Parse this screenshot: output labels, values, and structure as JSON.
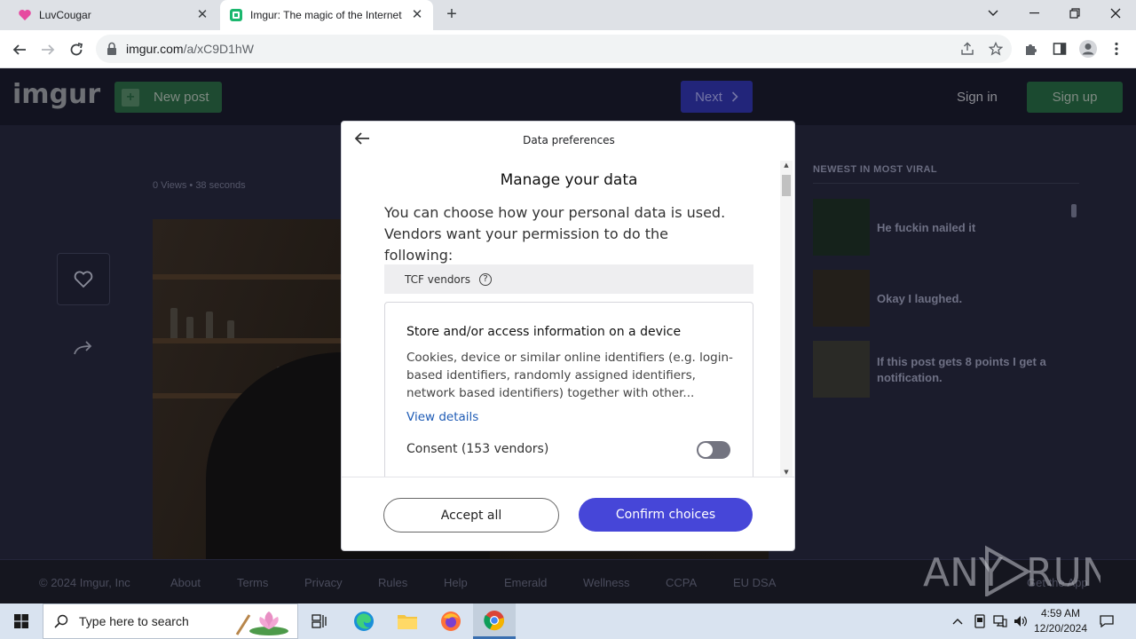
{
  "browser": {
    "tabs": [
      {
        "title": "LuvCougar",
        "favicon": "heart-favicon"
      },
      {
        "title": "Imgur: The magic of the Internet",
        "favicon": "imgur-favicon",
        "active": true
      }
    ],
    "url_host": "imgur.com",
    "url_path": "/a/xC9D1hW"
  },
  "imgur": {
    "logo": "imgur",
    "new_post": "New post",
    "next": "Next",
    "sign_in": "Sign in",
    "sign_up": "Sign up",
    "views": "0 Views",
    "age": "38 seconds",
    "sidebar_title": "NEWEST IN MOST VIRAL",
    "viral": [
      {
        "title": "He fuckin nailed it"
      },
      {
        "title": "Okay I laughed."
      },
      {
        "title": "If this post gets 8 points I get a notification."
      }
    ],
    "footer": [
      "© 2024 Imgur, Inc",
      "About",
      "Terms",
      "Privacy",
      "Rules",
      "Help",
      "Emerald",
      "Wellness",
      "CCPA",
      "EU DSA",
      "Get the App"
    ]
  },
  "modal": {
    "header": "Data preferences",
    "title": "Manage your data",
    "intro": "You can choose how your personal data is used. Vendors want your permission to do the following:",
    "section_label": "TCF vendors",
    "purpose": {
      "title": "Store and/or access information on a device",
      "description": "Cookies, device or similar online identifiers (e.g. login-based identifiers, randomly assigned identifiers, network based identifiers) together with other...",
      "details_link": "View details",
      "consent_label": "Consent (153 vendors)",
      "consent_enabled": false
    },
    "accept_all": "Accept all",
    "confirm": "Confirm choices"
  },
  "watermark": "ANY RUN",
  "taskbar": {
    "search_placeholder": "Type here to search",
    "time": "4:59 AM",
    "date": "12/20/2024"
  },
  "colors": {
    "confirm_button": "#4646d8",
    "link": "#1e5bb5",
    "imgur_green": "#1bb76e"
  }
}
